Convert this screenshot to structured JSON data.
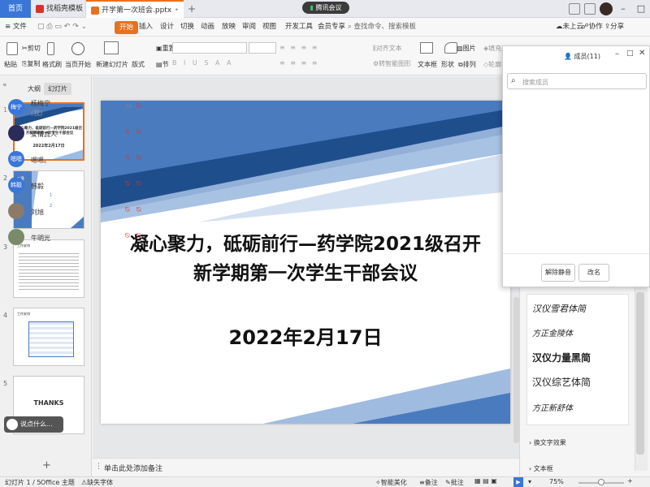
{
  "titlebar": {
    "home_tab": "首页",
    "template_tab": "找稻壳模板",
    "doc_tab": "开学第一次班会.pptx",
    "meeting": "腾讯会议"
  },
  "menu": {
    "file": "文件",
    "items": [
      "开始",
      "插入",
      "设计",
      "切换",
      "动画",
      "放映",
      "审阅",
      "视图",
      "开发工具",
      "会员专享"
    ],
    "search": "查找命令、搜索模板",
    "cloud": "未上云",
    "collab": "协作",
    "share": "分享"
  },
  "toolbar": {
    "paste": "粘贴",
    "cut": "剪切",
    "copy": "复制",
    "format_painter": "格式刷",
    "play_from_current": "当页开始",
    "new_slide": "新建幻灯片",
    "layout": "版式",
    "section": "节",
    "reset": "重置",
    "align_text": "对齐文本",
    "smart_graphic": "转智能图形",
    "textbox": "文本框",
    "shape": "形状",
    "arrange": "排列",
    "picture": "图片",
    "fill": "填充",
    "outline": "轮廓"
  },
  "leftpanel": {
    "tab_outline": "大纲",
    "tab_slides": "幻灯片",
    "slide1_title": "凝心聚力，砥砺前行—药学院2021级召开新学期第一次学生干部会议",
    "slide1_date": "2022年2月17日",
    "slide2_heading": "目录",
    "slide2_items": [
      "1",
      "2"
    ],
    "slide3_heading": "工作安排",
    "slide4_heading": "工作安排",
    "slide5_text": "THANKS"
  },
  "slide": {
    "title_line1": "凝心聚力，砥砺前行—药学院2021级召开",
    "title_line2": "新学期第一次学生干部会议",
    "date": "2022年2月17日"
  },
  "notes_placeholder": "单击此处添加备注",
  "chat_placeholder": "说点什么...",
  "members": {
    "title": "成员(11)",
    "search_placeholder": "搜索成员",
    "list": [
      {
        "avatar": "梅宁",
        "name": "杨梅宁",
        "sub": "(我)",
        "color": "#3a76d8"
      },
      {
        "avatar": "",
        "name": "爱情真人",
        "sub": "",
        "color": "#2c2c5a"
      },
      {
        "avatar": "嗯嗯",
        "name": "嗯嗯。",
        "sub": "",
        "color": "#3a76d8"
      },
      {
        "avatar": "韩毅",
        "name": "韩毅",
        "sub": "",
        "color": "#3a76d8"
      },
      {
        "avatar": "",
        "name": "刘旭",
        "sub": "",
        "color": "#8b7b6b"
      },
      {
        "avatar": "",
        "name": "牛明光",
        "sub": "",
        "color": "#7a8a6a"
      }
    ],
    "mute_all": "解除静音",
    "rename": "改名"
  },
  "rightpanel": {
    "font_samples": [
      "汉仪雪君体简",
      "方正金陵体",
      "汉仪力量黑简",
      "汉仪综艺体简",
      "方正新舒体"
    ],
    "text_effects": "换文字效果",
    "textbox": "文本框"
  },
  "statusbar": {
    "slide_count": "幻灯片 1 / 5",
    "theme": "Office 主题",
    "font_missing": "缺失字体",
    "smart_beautify": "智能美化",
    "notes": "备注",
    "comments": "批注",
    "zoom": "75%"
  },
  "colors": {
    "accent": "#e8711f",
    "slide_blue_dark": "#1f4e8c",
    "slide_blue": "#4a7bbf",
    "slide_blue_light": "#9fbbe0"
  }
}
